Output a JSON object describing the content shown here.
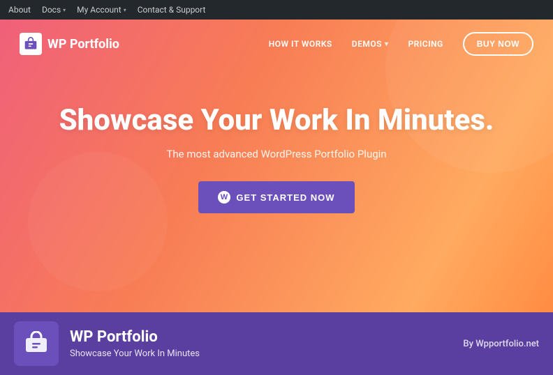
{
  "admin_bar": {
    "items": [
      {
        "label": "About",
        "has_dropdown": false
      },
      {
        "label": "Docs",
        "has_dropdown": true
      },
      {
        "label": "My Account",
        "has_dropdown": true
      },
      {
        "label": "Contact & Support",
        "has_dropdown": false
      }
    ]
  },
  "site": {
    "logo_text": "WP Portfolio",
    "nav": {
      "how_it_works": "HOW IT WORKS",
      "demos": "DEMOS",
      "pricing": "PRICING",
      "buy_now": "BUY NOW"
    },
    "hero": {
      "title": "Showcase Your Work In Minutes.",
      "subtitle": "The most advanced WordPress Portfolio Plugin",
      "cta": "GET STARTED NOW"
    }
  },
  "plugin": {
    "name": "WP Portfolio",
    "tagline": "Showcase Your Work In Minutes",
    "author_label": "By Wpportfolio.net"
  },
  "colors": {
    "purple_dark": "#5b3fa0",
    "purple_mid": "#6b4fbb",
    "admin_bar_bg": "#23282d"
  }
}
